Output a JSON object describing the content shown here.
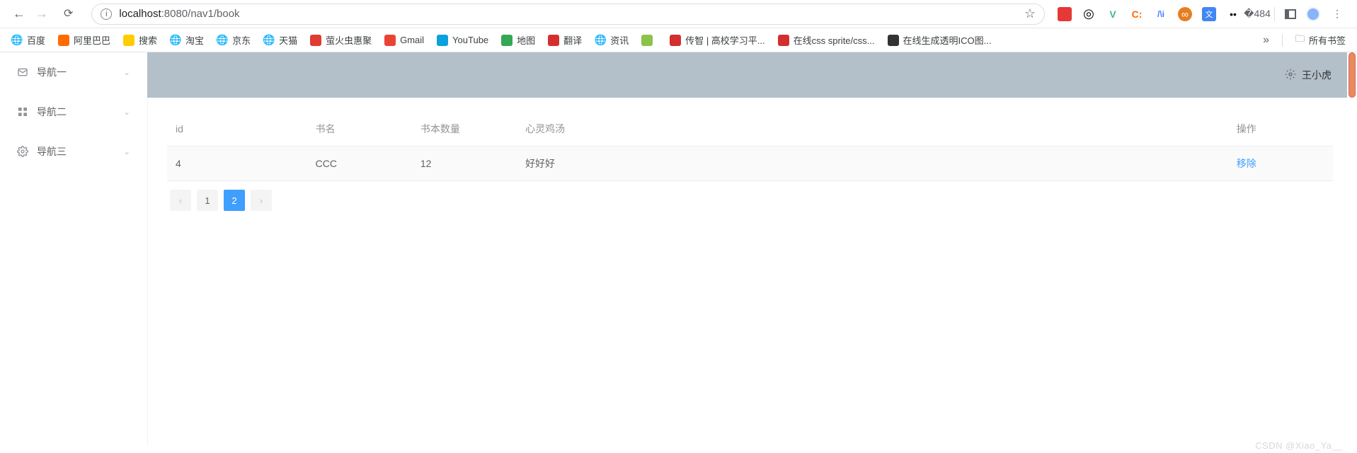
{
  "browser": {
    "url_host": "localhost",
    "url_port_path": ":8080/nav1/book",
    "bookmarks": [
      {
        "label": "百度",
        "color": "#888"
      },
      {
        "label": "阿里巴巴",
        "color": "#ff6a00"
      },
      {
        "label": "搜索",
        "color": "#ffcc00"
      },
      {
        "label": "淘宝",
        "color": "#888"
      },
      {
        "label": "京东",
        "color": "#888"
      },
      {
        "label": "天猫",
        "color": "#888"
      },
      {
        "label": "萤火虫惠聚",
        "color": "#e03c31"
      },
      {
        "label": "Gmail",
        "color": "#ea4335"
      },
      {
        "label": "YouTube",
        "color": "#0aa1dd"
      },
      {
        "label": "地图",
        "color": "#34a853"
      },
      {
        "label": "翻译",
        "color": "#d32f2f"
      },
      {
        "label": "资讯",
        "color": "#888"
      },
      {
        "label": "",
        "color": "#8bc34a"
      },
      {
        "label": "传智 | 高校学习平...",
        "color": "#d32f2f"
      },
      {
        "label": "在线css sprite/css...",
        "color": "#d32f2f"
      },
      {
        "label": "在线生成透明ICO图...",
        "color": "#333"
      }
    ],
    "all_bookmarks_label": "所有书签"
  },
  "sidebar": {
    "items": [
      {
        "label": "导航一"
      },
      {
        "label": "导航二"
      },
      {
        "label": "导航三"
      }
    ]
  },
  "header": {
    "username": "王小虎"
  },
  "table": {
    "columns": {
      "id": "id",
      "name": "书名",
      "qty": "书本数量",
      "soup": "心灵鸡汤",
      "op": "操作"
    },
    "rows": [
      {
        "id": "4",
        "name": "CCC",
        "qty": "12",
        "soup": "好好好",
        "op_label": "移除"
      }
    ]
  },
  "pagination": {
    "pages": [
      "1",
      "2"
    ],
    "active": "2"
  },
  "watermark": "CSDN @Xiao_Ya__"
}
